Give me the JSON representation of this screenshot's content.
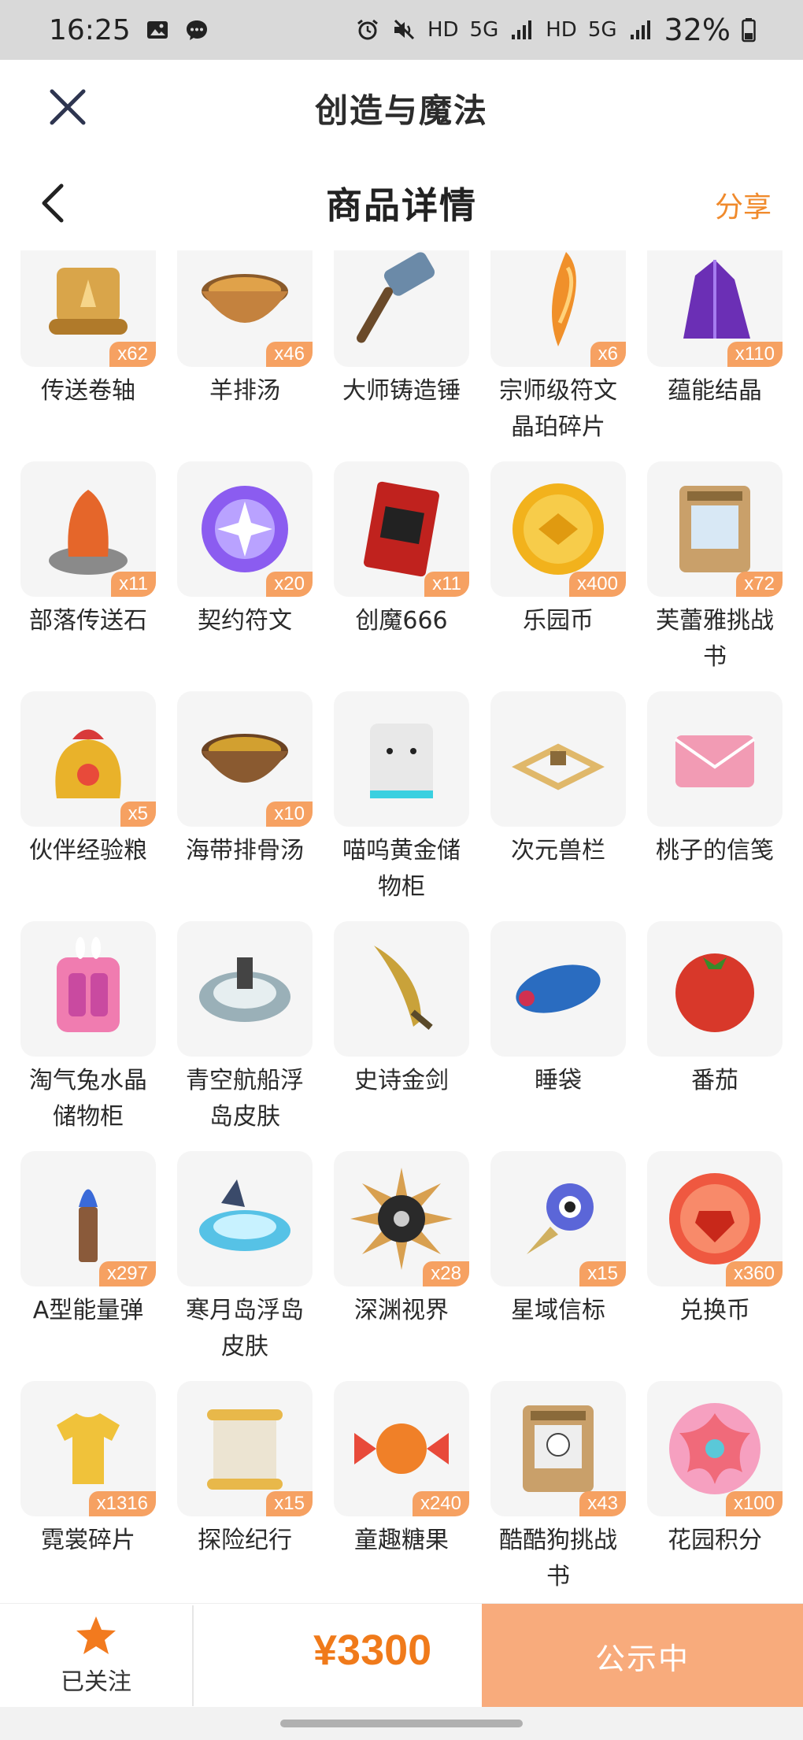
{
  "status": {
    "time": "16:25",
    "net1": "HD",
    "net2": "5G",
    "net3": "HD",
    "net4": "5G",
    "battery": "32%"
  },
  "header": {
    "app_title": "创造与魔法",
    "page_title": "商品详情",
    "share_label": "分享"
  },
  "items": [
    {
      "name": "传送卷轴",
      "count": "x62",
      "icon": "scroll-icon",
      "color": "#d9a54a"
    },
    {
      "name": "羊排汤",
      "count": "x46",
      "icon": "soup-bowl-icon",
      "color": "#c4823e"
    },
    {
      "name": "大师铸造锤",
      "count": "",
      "icon": "hammer-icon",
      "color": "#6b8aa8"
    },
    {
      "name": "宗师级符文晶珀碎片",
      "count": "x6",
      "icon": "amber-shard-icon",
      "color": "#f0902a"
    },
    {
      "name": "蕴能结晶",
      "count": "x110",
      "icon": "purple-crystal-icon",
      "color": "#6b2fb5"
    },
    {
      "name": "部落传送石",
      "count": "x11",
      "icon": "teleport-stone-icon",
      "color": "#e5662a"
    },
    {
      "name": "契约符文",
      "count": "x20",
      "icon": "rune-orb-icon",
      "color": "#8b5cf0"
    },
    {
      "name": "创魔666",
      "count": "x11",
      "icon": "card-icon",
      "color": "#c0221e"
    },
    {
      "name": "乐园币",
      "count": "x400",
      "icon": "gold-coin-icon",
      "color": "#f2b21c"
    },
    {
      "name": "芙蕾雅挑战书",
      "count": "x72",
      "icon": "wanted-poster-icon",
      "color": "#c9a06a"
    },
    {
      "name": "伙伴经验粮",
      "count": "x5",
      "icon": "paw-bag-icon",
      "color": "#e9b22a"
    },
    {
      "name": "海带排骨汤",
      "count": "x10",
      "icon": "stew-bowl-icon",
      "color": "#d2a030"
    },
    {
      "name": "喵呜黄金储物柜",
      "count": "",
      "icon": "cat-locker-icon",
      "color": "#e8e8e8"
    },
    {
      "name": "次元兽栏",
      "count": "",
      "icon": "fence-icon",
      "color": "#e0b86a"
    },
    {
      "name": "桃子的信笺",
      "count": "",
      "icon": "envelope-icon",
      "color": "#f29bb4"
    },
    {
      "name": "淘气兔水晶储物柜",
      "count": "",
      "icon": "bunny-cabinet-icon",
      "color": "#f07cb0"
    },
    {
      "name": "青空航船浮岛皮肤",
      "count": "",
      "icon": "island-icon",
      "color": "#9ab0b8"
    },
    {
      "name": "史诗金剑",
      "count": "",
      "icon": "golden-sword-icon",
      "color": "#c9a23a"
    },
    {
      "name": "睡袋",
      "count": "",
      "icon": "sleeping-bag-icon",
      "color": "#2a6cc0"
    },
    {
      "name": "番茄",
      "count": "",
      "icon": "tomato-icon",
      "color": "#d8382a"
    },
    {
      "name": "A型能量弹",
      "count": "x297",
      "icon": "energy-bullet-icon",
      "color": "#3a6ad8"
    },
    {
      "name": "寒月岛浮岛皮肤",
      "count": "",
      "icon": "ice-island-icon",
      "color": "#56c2e6"
    },
    {
      "name": "深渊视界",
      "count": "x28",
      "icon": "abyss-sun-icon",
      "color": "#2a2a2a"
    },
    {
      "name": "星域信标",
      "count": "x15",
      "icon": "star-beacon-icon",
      "color": "#5b66d8"
    },
    {
      "name": "兑换币",
      "count": "x360",
      "icon": "red-coin-icon",
      "color": "#ef5840"
    },
    {
      "name": "霓裳碎片",
      "count": "x1316",
      "icon": "shirt-icon",
      "color": "#f0c23a"
    },
    {
      "name": "探险纪行",
      "count": "x15",
      "icon": "paper-scroll-icon",
      "color": "#ece4d2"
    },
    {
      "name": "童趣糖果",
      "count": "x240",
      "icon": "candy-icon",
      "color": "#f08028"
    },
    {
      "name": "酷酷狗挑战书",
      "count": "x43",
      "icon": "wanted-dog-icon",
      "color": "#c9a06a"
    },
    {
      "name": "花园积分",
      "count": "x100",
      "icon": "flower-badge-icon",
      "color": "#f06a7a"
    }
  ],
  "bottom": {
    "follow_label": "已关注",
    "price": "¥3300",
    "publish_label": "公示中",
    "accent": "#f08a2c",
    "button_color": "#f8ab7c"
  }
}
